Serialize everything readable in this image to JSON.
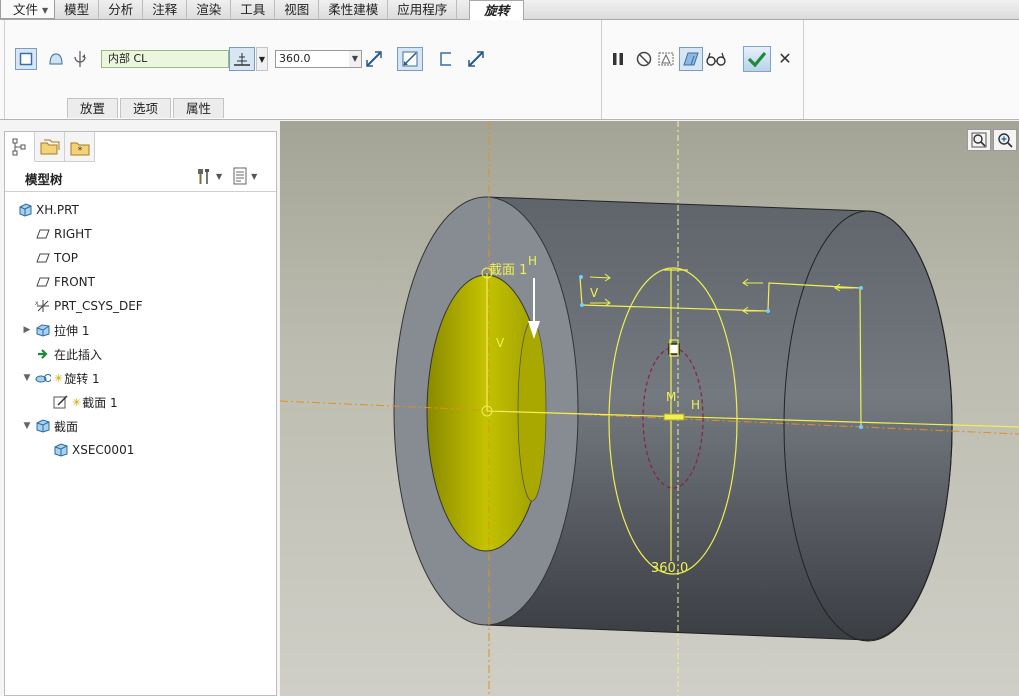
{
  "menu": {
    "file": "文件",
    "items": [
      "模型",
      "分析",
      "注释",
      "渲染",
      "工具",
      "视图",
      "柔性建模",
      "应用程序"
    ],
    "active_tab": "旋转"
  },
  "ribbon": {
    "sketch_name": "内部 CL",
    "angle_value": "360.0",
    "sub_tabs": [
      "放置",
      "选项",
      "属性"
    ]
  },
  "model_tree": {
    "title": "模型树",
    "items": [
      {
        "label": "XH.PRT",
        "icon": "part-icon",
        "indent": 0,
        "expander": ""
      },
      {
        "label": "RIGHT",
        "icon": "datum-plane-icon",
        "indent": 1,
        "expander": ""
      },
      {
        "label": "TOP",
        "icon": "datum-plane-icon",
        "indent": 1,
        "expander": ""
      },
      {
        "label": "FRONT",
        "icon": "datum-plane-icon",
        "indent": 1,
        "expander": ""
      },
      {
        "label": "PRT_CSYS_DEF",
        "icon": "csys-icon",
        "indent": 1,
        "expander": ""
      },
      {
        "label": "拉伸 1",
        "icon": "extrude-icon",
        "indent": 1,
        "expander": "▶"
      },
      {
        "label": "在此插入",
        "icon": "insert-here-icon",
        "indent": 1,
        "expander": ""
      },
      {
        "label": "旋转 1",
        "icon": "revolve-icon",
        "indent": 1,
        "expander": "▼"
      },
      {
        "label": "截面 1",
        "icon": "sketch-icon",
        "indent": 2,
        "expander": ""
      },
      {
        "label": "截面",
        "icon": "section-icon",
        "indent": 1,
        "expander": "▼"
      },
      {
        "label": "XSEC0001",
        "icon": "xsec-icon",
        "indent": 2,
        "expander": ""
      }
    ]
  },
  "viewport": {
    "section_label": "截面 1",
    "h_label": "H",
    "v_label": "V",
    "m_label": "M",
    "angle_dim": "360.0"
  },
  "colors": {
    "sketch": "#f0f050",
    "cylinder": "#6e737b",
    "bore": "#b5b400",
    "axis": "#e09020"
  }
}
